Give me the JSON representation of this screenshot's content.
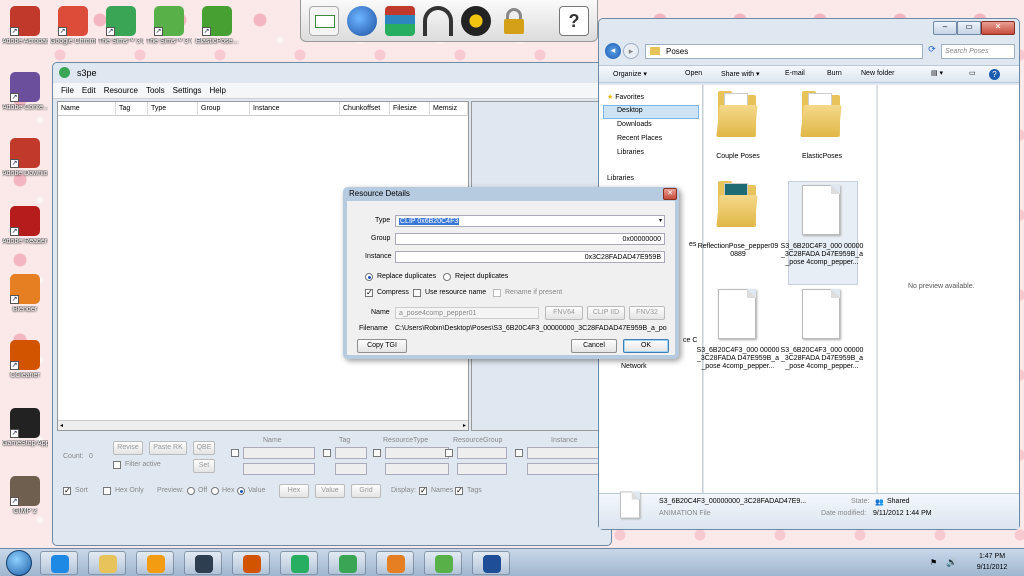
{
  "desktop_icons": [
    {
      "label": "Adobe Acrobat...",
      "icon": "acrobat-icon",
      "color": "#c0392b"
    },
    {
      "label": "Google Chrome",
      "icon": "chrome-icon",
      "color": "#dd4b39"
    },
    {
      "label": "The Sims™ 3 Late Nig...",
      "icon": "sims-icon",
      "color": "#3aa655"
    },
    {
      "label": "The Sims™ 3 World Adv...",
      "icon": "sims-icon",
      "color": "#58b148"
    },
    {
      "label": "ElasticPose...",
      "icon": "elasticpose-icon",
      "color": "#46a032"
    },
    {
      "label": "Adobe Conte...",
      "icon": "adobe-content-icon",
      "color": "#6b4f9c"
    },
    {
      "label": "Adobe Downlo...",
      "icon": "adobe-download-icon",
      "color": "#c0392b"
    },
    {
      "label": "Adobe Reader 9",
      "icon": "adobe-reader-icon",
      "color": "#b71c1c"
    },
    {
      "label": "Blender",
      "icon": "blender-icon",
      "color": "#e67e22"
    },
    {
      "label": "CCleaner",
      "icon": "ccleaner-icon",
      "color": "#d35400"
    },
    {
      "label": "GameStop App",
      "icon": "gamestop-icon",
      "color": "#222222"
    },
    {
      "label": "GIMP 2",
      "icon": "gimp-icon",
      "color": "#6e5f4e"
    },
    {
      "label": "Dieses Stuff",
      "icon": "folder-icon",
      "color": "#e7c35a"
    },
    {
      "label": "Textn Lette...",
      "icon": "folder-icon",
      "color": "#e7c35a"
    }
  ],
  "quick_toolbar": [
    "mail-icon",
    "globe-icon",
    "books-icon",
    "headphones-icon",
    "film-reel-icon",
    "padlock-icon",
    "help-icon"
  ],
  "s3pe": {
    "title": "s3pe",
    "menu": [
      "File",
      "Edit",
      "Resource",
      "Tools",
      "Settings",
      "Help"
    ],
    "columns": [
      "Name",
      "Tag",
      "Type",
      "Group",
      "Instance",
      "Chunkoffset",
      "Filesize",
      "Memsiz"
    ],
    "buttons": {
      "revise": "Revise",
      "paste_rk": "Paste RK",
      "qbe": "QBE",
      "set": "Set",
      "hex": "Hex",
      "value": "Value",
      "grid": "Grid"
    },
    "count_label": "Count:",
    "count_value": "0",
    "filter_active": "Filter active",
    "filter_cols": [
      "Name",
      "Tag",
      "ResourceType",
      "ResourceGroup",
      "Instance"
    ],
    "sort": "Sort",
    "hex_only": "Hex Only",
    "preview": "Preview:",
    "off": "Off",
    "hex_opt": "Hex",
    "value_opt": "Value",
    "display": "Display:",
    "names": "Names",
    "tags": "Tags"
  },
  "dialog": {
    "title": "Resource Details",
    "type_label": "Type",
    "type_value": "CLIP 0x6B20C4F3",
    "group_label": "Group",
    "group_value": "0x00000000",
    "instance_label": "Instance",
    "instance_value": "0x3C28FADAD47E959B",
    "replace_dup": "Replace duplicates",
    "reject_dup": "Reject duplicates",
    "compress": "Compress",
    "use_res_name": "Use resource name",
    "rename": "Rename if present",
    "name_label": "Name",
    "name_value": "a_pose4comp_pepper01",
    "fnv64": "FNV64",
    "clip_iid": "CLIP IID",
    "fnv32": "FNV32",
    "filename_label": "Filename",
    "filename_value": "C:\\Users\\Robin\\Desktop\\Poses\\S3_6B20C4F3_00000000_3C28FADAD47E959B_a_pos",
    "copy_tgi": "Copy TGI",
    "cancel": "Cancel",
    "ok": "OK",
    "close": "✕"
  },
  "explorer": {
    "breadcrumb": "Poses",
    "search_placeholder": "Search Poses",
    "toolbar": [
      "Organize ▾",
      "Open",
      "Share with ▾",
      "E-mail",
      "Burn",
      "New folder"
    ],
    "nav": {
      "favorites": "Favorites",
      "desktop": "Desktop",
      "downloads": "Downloads",
      "recent": "Recent Places",
      "libraries1": "Libraries",
      "libraries2": "Libraries",
      "network": "Network",
      "partial1": "es",
      "partial2": "ce C"
    },
    "items": [
      {
        "label": "Couple Poses",
        "kind": "folder"
      },
      {
        "label": "ElasticPoses",
        "kind": "folder"
      },
      {
        "label": "ReflectionPose_pepper090889",
        "kind": "folder"
      },
      {
        "label": "S3_6B20C4F3_000 00000_3C28FADA D47E959B_a_pose 4comp_pepper...",
        "kind": "file"
      },
      {
        "label": "S3_6B20C4F3_000 00000_3C28FADA D47E959B_a_pose 4comp_pepper...",
        "kind": "file"
      },
      {
        "label": "S3_6B20C4F3_000 00000_3C28FADA D47E959B_a_pose 4comp_pepper...",
        "kind": "file"
      }
    ],
    "no_preview": "No preview available.",
    "details": {
      "filename": "S3_6B20C4F3_00000000_3C28FADAD47E9...",
      "type": "ANIMATION File",
      "state_label": "State:",
      "state": "Shared",
      "modified_label": "Date modified:",
      "modified": "9/11/2012 1:44 PM"
    }
  },
  "taskbar": {
    "time": "1:47 PM",
    "date": "9/11/2012",
    "apps": [
      "ie-icon",
      "explorer-icon",
      "media-player-icon",
      "sims-globe-icon",
      "powerpoint-icon",
      "talk-icon",
      "sims-icon",
      "blender-icon",
      "sims-icon",
      "word-icon"
    ]
  }
}
